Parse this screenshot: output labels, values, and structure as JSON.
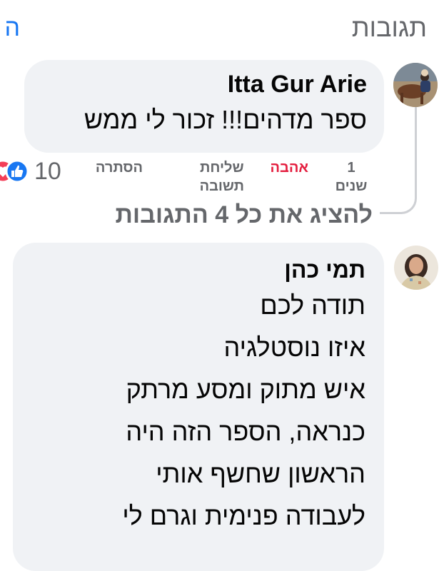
{
  "header": {
    "title": "תגובות",
    "link_fragment": "ה"
  },
  "comments": [
    {
      "author": "Itta Gur Arie",
      "text": "ספר מדהים!!! זכור לי ממש",
      "time_line1": "1",
      "time_line2": "שנים",
      "love_label": "אהבה",
      "reply_line1": "שליחת",
      "reply_line2": "תשובה",
      "hide_label": "הסתרה",
      "reaction_count": "10",
      "reaction_icons": [
        "like-icon",
        "love-icon"
      ]
    }
  ],
  "view_all_replies": "להציג את כל 4 התגובות",
  "comment2": {
    "author": "תמי כהן",
    "lines": [
      "תודה לכם",
      "איזו נוסטלגיה",
      "איש מתוק ומסע מרתק",
      "כנראה, הספר הזה היה",
      "הראשון שחשף אותי",
      "לעבודה פנימית וגרם לי"
    ]
  },
  "colors": {
    "bubble": "#f0f2f5",
    "secondary_text": "#65676b",
    "love_red": "#e41e3f",
    "link_blue": "#1877f2",
    "thread_line": "#ced0d4"
  }
}
